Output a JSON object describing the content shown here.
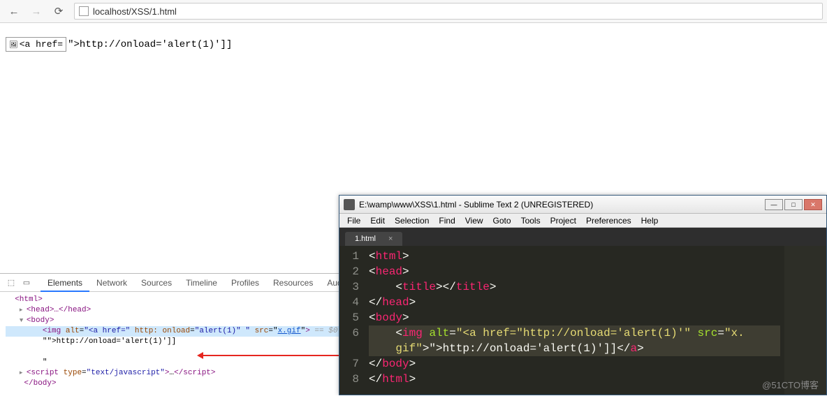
{
  "browser": {
    "url": "localhost/XSS/1.html",
    "back_enabled": true,
    "forward_enabled": false
  },
  "page": {
    "broken_alt": "<a href=",
    "trailing_text": "\">http://onload='alert(1)']]"
  },
  "devtools": {
    "tabs": [
      "Elements",
      "Network",
      "Sources",
      "Timeline",
      "Profiles",
      "Resources",
      "Audits"
    ],
    "active_tab": "Elements",
    "code": {
      "html_open": "<html>",
      "head": "<head>…</head>",
      "body_open": "<body>",
      "img_tag_name": "img",
      "img_alt_attr": "alt",
      "img_alt_val": "\"<a href=\"",
      "img_http": "http:",
      "img_onload_attr": "onload",
      "img_onload_val": "\"alert(1)\" \"",
      "img_src_attr": "src",
      "img_src_val": "x.gif",
      "eq": " == $0",
      "text1": "\"\">http://onload='alert(1)']]",
      "quote": "\"",
      "script_tag": "script",
      "script_type_attr": "type",
      "script_type_val": "\"text/javascript\"",
      "body_close": "</body>"
    }
  },
  "sublime": {
    "title": "E:\\wamp\\www\\XSS\\1.html - Sublime Text 2 (UNREGISTERED)",
    "menu": [
      "File",
      "Edit",
      "Selection",
      "Find",
      "View",
      "Goto",
      "Tools",
      "Project",
      "Preferences",
      "Help"
    ],
    "tab": "1.html",
    "lines": {
      "1": {
        "ind": 0,
        "open": "html"
      },
      "2": {
        "ind": 0,
        "open": "head"
      },
      "3_open": "title",
      "3_close": "title",
      "4": {
        "ind": 0,
        "close": "head"
      },
      "5": {
        "ind": 0,
        "open": "body"
      },
      "6a_tag": "img",
      "6a_alt": "alt",
      "6a_alt_v": "\"<a href=\"",
      "6a_http": "http://onload='alert(1)'",
      "6a_src": "src",
      "6a_src_v": "\"x.",
      "6b_gif": "gif\"",
      "6b_txt": ">\">http://onload='alert(1)']]",
      "6b_close": "a",
      "7": {
        "ind": 0,
        "close": "body"
      },
      "8": {
        "ind": 0,
        "close": "html"
      }
    }
  },
  "watermark": "@51CTO博客"
}
